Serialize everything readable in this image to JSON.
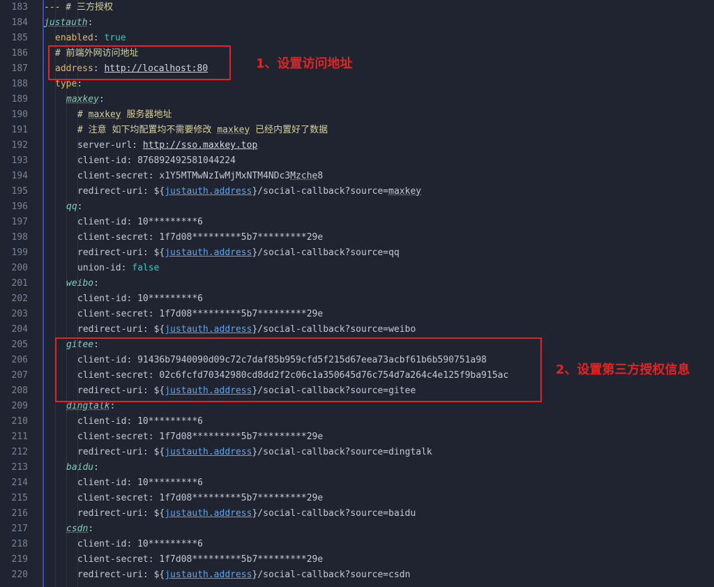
{
  "lines": [
    {
      "n": "183",
      "ind": 0,
      "parts": [
        {
          "t": "--- # 三方授权",
          "c": "cm"
        }
      ]
    },
    {
      "n": "184",
      "ind": 0,
      "parts": [
        {
          "t": "justauth",
          "c": "sub ul"
        },
        {
          "t": ":",
          "c": "k"
        }
      ]
    },
    {
      "n": "185",
      "ind": 1,
      "parts": [
        {
          "t": "enabled",
          "c": "key"
        },
        {
          "t": ": ",
          "c": "k"
        },
        {
          "t": "true",
          "c": "kw"
        }
      ]
    },
    {
      "n": "186",
      "ind": 1,
      "parts": [
        {
          "t": "# 前端外网访问地址",
          "c": "cm"
        }
      ]
    },
    {
      "n": "187",
      "ind": 1,
      "parts": [
        {
          "t": "address",
          "c": "key"
        },
        {
          "t": ": ",
          "c": "k"
        },
        {
          "t": "http://localhost:80",
          "c": "url"
        }
      ]
    },
    {
      "n": "188",
      "ind": 1,
      "parts": [
        {
          "t": "type",
          "c": "key"
        },
        {
          "t": ":",
          "c": "k"
        }
      ]
    },
    {
      "n": "189",
      "ind": 2,
      "parts": [
        {
          "t": "maxkey",
          "c": "sub ul"
        },
        {
          "t": ":",
          "c": "k"
        }
      ]
    },
    {
      "n": "190",
      "ind": 3,
      "parts": [
        {
          "t": "# ",
          "c": "cm"
        },
        {
          "t": "maxkey",
          "c": "cm ul"
        },
        {
          "t": " 服务器地址",
          "c": "cm"
        }
      ]
    },
    {
      "n": "191",
      "ind": 3,
      "parts": [
        {
          "t": "# 注意 如下均配置均不需要修改 ",
          "c": "cm"
        },
        {
          "t": "maxkey",
          "c": "cm ul"
        },
        {
          "t": " 已经内置好了数据",
          "c": "cm"
        }
      ]
    },
    {
      "n": "192",
      "ind": 3,
      "parts": [
        {
          "t": "server-url: ",
          "c": "k"
        },
        {
          "t": "http://sso.maxkey.top",
          "c": "url"
        }
      ]
    },
    {
      "n": "193",
      "ind": 3,
      "parts": [
        {
          "t": "client-id: 876892492581044224",
          "c": "k"
        }
      ]
    },
    {
      "n": "194",
      "ind": 3,
      "parts": [
        {
          "t": "client-secret: x1Y5MTMwNzIwMjMxNTM4NDc3",
          "c": "k"
        },
        {
          "t": "Mzche",
          "c": "k ul"
        },
        {
          "t": "8",
          "c": "k"
        }
      ]
    },
    {
      "n": "195",
      "ind": 3,
      "parts": [
        {
          "t": "redirect-uri: ${",
          "c": "k"
        },
        {
          "t": "justauth.address",
          "c": "tpl"
        },
        {
          "t": "}/social-callback?source=",
          "c": "k"
        },
        {
          "t": "maxkey",
          "c": "k ul"
        }
      ]
    },
    {
      "n": "196",
      "ind": 2,
      "parts": [
        {
          "t": "qq",
          "c": "sub"
        },
        {
          "t": ":",
          "c": "k"
        }
      ]
    },
    {
      "n": "197",
      "ind": 3,
      "parts": [
        {
          "t": "client-id: 10*********6",
          "c": "k"
        }
      ]
    },
    {
      "n": "198",
      "ind": 3,
      "parts": [
        {
          "t": "client-secret: 1f7d08*********5b7*********29e",
          "c": "k"
        }
      ]
    },
    {
      "n": "199",
      "ind": 3,
      "parts": [
        {
          "t": "redirect-uri: ${",
          "c": "k"
        },
        {
          "t": "justauth.address",
          "c": "tpl"
        },
        {
          "t": "}/social-callback?source=qq",
          "c": "k"
        }
      ]
    },
    {
      "n": "200",
      "ind": 3,
      "parts": [
        {
          "t": "union-id: ",
          "c": "k"
        },
        {
          "t": "false",
          "c": "kw"
        }
      ]
    },
    {
      "n": "201",
      "ind": 2,
      "parts": [
        {
          "t": "weibo",
          "c": "sub"
        },
        {
          "t": ":",
          "c": "k"
        }
      ]
    },
    {
      "n": "202",
      "ind": 3,
      "parts": [
        {
          "t": "client-id: 10*********6",
          "c": "k"
        }
      ]
    },
    {
      "n": "203",
      "ind": 3,
      "parts": [
        {
          "t": "client-secret: 1f7d08*********5b7*********29e",
          "c": "k"
        }
      ]
    },
    {
      "n": "204",
      "ind": 3,
      "parts": [
        {
          "t": "redirect-uri: ${",
          "c": "k"
        },
        {
          "t": "justauth.address",
          "c": "tpl"
        },
        {
          "t": "}/social-callback?source=weibo",
          "c": "k"
        }
      ]
    },
    {
      "n": "205",
      "ind": 2,
      "parts": [
        {
          "t": "gitee",
          "c": "sub"
        },
        {
          "t": ":",
          "c": "k"
        }
      ]
    },
    {
      "n": "206",
      "ind": 3,
      "parts": [
        {
          "t": "client-id: 91436b7940090d09c72c7daf85b959cfd5f215d67eea73acbf61b6b590751a98",
          "c": "k"
        }
      ]
    },
    {
      "n": "207",
      "ind": 3,
      "parts": [
        {
          "t": "client-secret: 02c6fcfd70342980cd8dd2f2c06c1a350645d76c754d7a264c4e125f9ba915ac",
          "c": "k"
        }
      ]
    },
    {
      "n": "208",
      "ind": 3,
      "parts": [
        {
          "t": "redirect-uri: ${",
          "c": "k"
        },
        {
          "t": "justauth.address",
          "c": "tpl"
        },
        {
          "t": "}/social-callback?source=gitee",
          "c": "k"
        }
      ]
    },
    {
      "n": "209",
      "ind": 2,
      "parts": [
        {
          "t": "dingtalk",
          "c": "sub ul"
        },
        {
          "t": ":",
          "c": "k"
        }
      ]
    },
    {
      "n": "210",
      "ind": 3,
      "parts": [
        {
          "t": "client-id: 10*********6",
          "c": "k"
        }
      ]
    },
    {
      "n": "211",
      "ind": 3,
      "parts": [
        {
          "t": "client-secret: 1f7d08*********5b7*********29e",
          "c": "k"
        }
      ]
    },
    {
      "n": "212",
      "ind": 3,
      "parts": [
        {
          "t": "redirect-uri: ${",
          "c": "k"
        },
        {
          "t": "justauth.address",
          "c": "tpl"
        },
        {
          "t": "}/social-callback?source=dingtalk",
          "c": "k"
        }
      ]
    },
    {
      "n": "213",
      "ind": 2,
      "parts": [
        {
          "t": "baidu",
          "c": "sub"
        },
        {
          "t": ":",
          "c": "k"
        }
      ]
    },
    {
      "n": "214",
      "ind": 3,
      "parts": [
        {
          "t": "client-id: 10*********6",
          "c": "k"
        }
      ]
    },
    {
      "n": "215",
      "ind": 3,
      "parts": [
        {
          "t": "client-secret: 1f7d08*********5b7*********29e",
          "c": "k"
        }
      ]
    },
    {
      "n": "216",
      "ind": 3,
      "parts": [
        {
          "t": "redirect-uri: ${",
          "c": "k"
        },
        {
          "t": "justauth.address",
          "c": "tpl"
        },
        {
          "t": "}/social-callback?source=baidu",
          "c": "k"
        }
      ]
    },
    {
      "n": "217",
      "ind": 2,
      "parts": [
        {
          "t": "csdn",
          "c": "sub ul"
        },
        {
          "t": ":",
          "c": "k"
        }
      ]
    },
    {
      "n": "218",
      "ind": 3,
      "parts": [
        {
          "t": "client-id: 10*********6",
          "c": "k"
        }
      ]
    },
    {
      "n": "219",
      "ind": 3,
      "parts": [
        {
          "t": "client-secret: 1f7d08*********5b7*********29e",
          "c": "k"
        }
      ]
    },
    {
      "n": "220",
      "ind": 3,
      "parts": [
        {
          "t": "redirect-uri: ${",
          "c": "k"
        },
        {
          "t": "justauth.address",
          "c": "tpl"
        },
        {
          "t": "}/social-callback?source=csdn",
          "c": "k"
        }
      ]
    }
  ],
  "annotations": {
    "note1": "1、设置访问地址",
    "note2": "2、设置第三方授权信息"
  },
  "colors": {
    "background": "#1f2430",
    "annotation": "#e12525",
    "line_number": "#7a8496"
  }
}
